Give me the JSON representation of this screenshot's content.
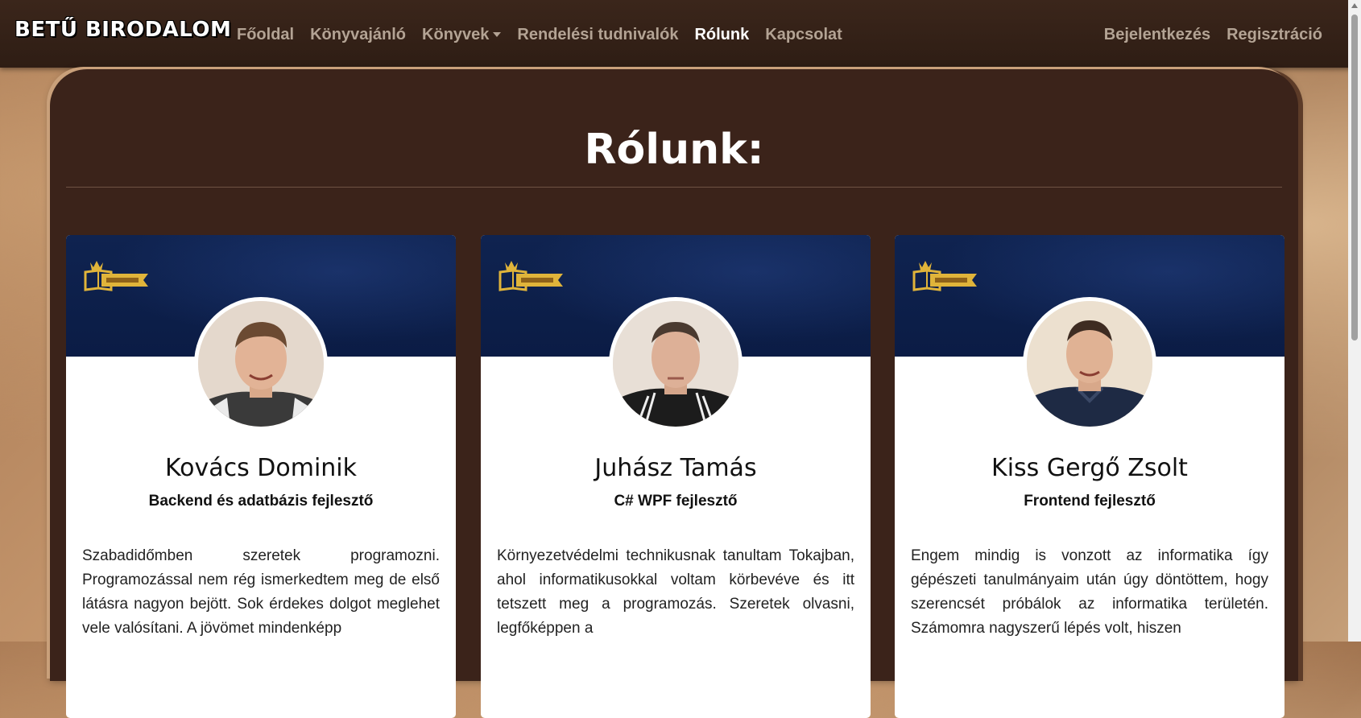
{
  "navbar": {
    "brand": "BETŰ BIRODALOM",
    "links": [
      {
        "label": "Főoldal",
        "active": false
      },
      {
        "label": "Könyvajánló",
        "active": false
      },
      {
        "label": "Könyvek",
        "active": false,
        "dropdown": true
      },
      {
        "label": "Rendelési tudnivalók",
        "active": false
      },
      {
        "label": "Rólunk",
        "active": true
      },
      {
        "label": "Kapcsolat",
        "active": false
      }
    ],
    "right_links": [
      {
        "label": "Bejelentkezés"
      },
      {
        "label": "Regisztráció"
      }
    ]
  },
  "page": {
    "title": "Rólunk:"
  },
  "cards": [
    {
      "name": "Kovács Dominik",
      "role": "Backend és adatbázis fejlesztő",
      "text": "Szabadidőmben szeretek programozni. Programozással nem rég ismerkedtem meg de első látásra nagyon bejött. Sok érdekes dolgot meglehet vele valósítani. A jövömet mindenképp",
      "banner_logo": "betu-birodalom-logo"
    },
    {
      "name": "Juhász Tamás",
      "role": "C# WPF fejlesztő",
      "text": "Környezetvédelmi technikusnak tanultam Tokajban, ahol informatikusokkal voltam körbevéve és itt tetszett meg a programozás. Szeretek olvasni, legfőképpen a",
      "banner_logo": "betu-birodalom-logo"
    },
    {
      "name": "Kiss Gergő Zsolt",
      "role": "Frontend fejlesztő",
      "text": "Engem mindig is vonzott az informatika így gépészeti tanulmányaim után úgy döntöttem, hogy szerencsét próbálok az informatika területén. Számomra nagyszerű lépés volt, hiszen",
      "banner_logo": "betu-birodalom-logo"
    }
  ],
  "colors": {
    "navbar_bg": "#2e1d14",
    "panel_bg": "#3b231a",
    "nav_link": "#b3a394",
    "nav_active": "#ffffff",
    "card_banner": "#0b1c45",
    "logo_gold": "#e0b43a"
  }
}
